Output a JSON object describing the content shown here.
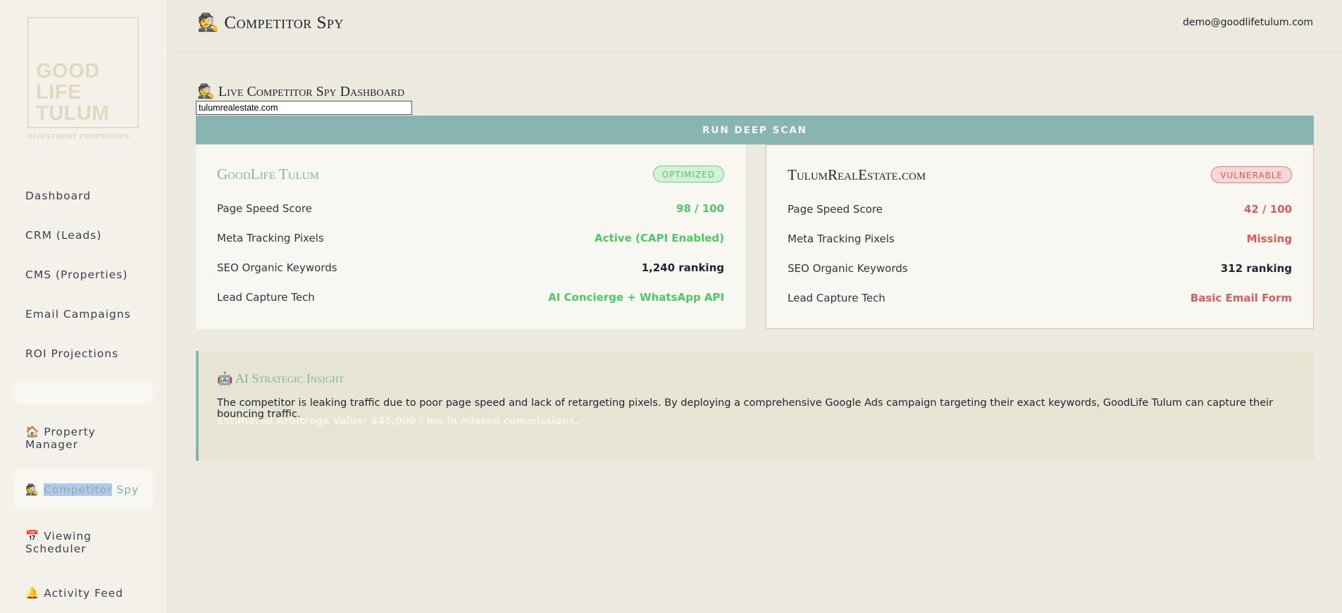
{
  "brand": {
    "logo_lines": [
      "GOOD",
      "LIFE",
      "TULUM"
    ],
    "logo_sub": "INVESTMENT PROPERTIES"
  },
  "sidebar": {
    "items": [
      {
        "label": "Dashboard"
      },
      {
        "label": "CRM (Leads)"
      },
      {
        "label": "CMS (Properties)"
      },
      {
        "label": "Email Campaigns"
      },
      {
        "label": "ROI Projections"
      }
    ],
    "property_manager": {
      "icon": "🏠",
      "label": "Property Manager"
    },
    "competitor_spy": {
      "icon": "🕵️",
      "label_selected": "Competitor",
      "label_rest": " Spy"
    },
    "viewing_scheduler": {
      "icon": "📅",
      "label": "Viewing Scheduler"
    },
    "activity_feed": {
      "icon": "🔔",
      "label": "Activity Feed"
    }
  },
  "header": {
    "icon": "🕵️",
    "title": "Competitor Spy",
    "user_email": "demo@goodlifetulum.com"
  },
  "dashboard": {
    "icon": "🕵️",
    "title": "Live Competitor Spy Dashboard",
    "domain_value": "tulumrealestate.com",
    "scan_button": "RUN DEEP SCAN"
  },
  "cards": {
    "ours": {
      "name": "GoodLife Tulum",
      "badge": "OPTIMIZED",
      "rows": [
        {
          "label": "Page Speed Score",
          "value": "98 / 100"
        },
        {
          "label": "Meta Tracking Pixels",
          "value": "Active (CAPI Enabled)"
        },
        {
          "label": "SEO Organic Keywords",
          "value": "1,240 ranking"
        },
        {
          "label": "Lead Capture Tech",
          "value": "AI Concierge + WhatsApp API"
        }
      ]
    },
    "theirs": {
      "name": "TulumRealEstate.com",
      "badge": "VULNERABLE",
      "rows": [
        {
          "label": "Page Speed Score",
          "value": "42 / 100"
        },
        {
          "label": "Meta Tracking Pixels",
          "value": "Missing"
        },
        {
          "label": "SEO Organic Keywords",
          "value": "312 ranking"
        },
        {
          "label": "Lead Capture Tech",
          "value": "Basic Email Form"
        }
      ]
    }
  },
  "insight": {
    "icon": "🤖",
    "title": "AI Strategic Insight",
    "body": "The competitor is leaking traffic due to poor page speed and lack of retargeting pixels. By deploying a comprehensive Google Ads campaign targeting their exact keywords, GoodLife Tulum can capture their bouncing traffic.",
    "estimate": "Estimated Arbitrage Value: $45,000 / mo in missed commissions."
  },
  "colors": {
    "accent": "#88b4b1",
    "good": "#4ccb63",
    "bad": "#de5b5b"
  }
}
